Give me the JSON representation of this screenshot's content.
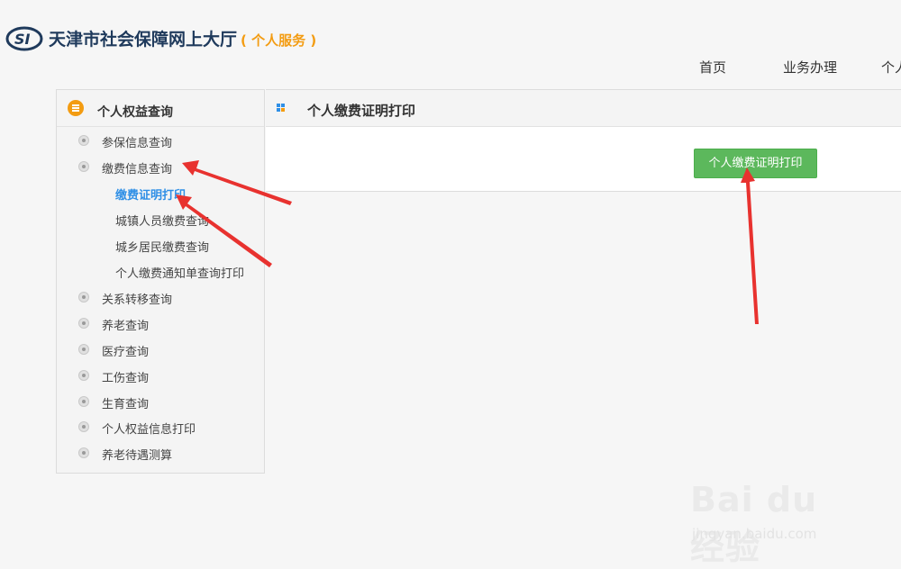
{
  "header": {
    "title": "天津市社会保障网上大厅",
    "subtitle": "( 个人服务 )",
    "logo_text": "SI",
    "nav": [
      "首页",
      "业务办理",
      "个人"
    ]
  },
  "sidebar": {
    "heading": "个人权益查询",
    "items": [
      {
        "label": "参保信息查询"
      },
      {
        "label": "缴费信息查询",
        "children": [
          {
            "label": "缴费证明打印",
            "active": true
          },
          {
            "label": "城镇人员缴费查询"
          },
          {
            "label": "城乡居民缴费查询"
          },
          {
            "label": "个人缴费通知单查询打印"
          }
        ]
      },
      {
        "label": "关系转移查询"
      },
      {
        "label": "养老查询"
      },
      {
        "label": "医疗查询"
      },
      {
        "label": "工伤查询"
      },
      {
        "label": "生育查询"
      },
      {
        "label": "个人权益信息打印"
      },
      {
        "label": "养老待遇测算"
      }
    ]
  },
  "panel": {
    "title": "个人缴费证明打印",
    "button_label": "个人缴费证明打印"
  },
  "watermark": {
    "text": "Bai du 经验",
    "url": "jingyan.baidu.com"
  },
  "colors": {
    "accent_orange": "#f39c12",
    "link_blue": "#2f8fe6",
    "button_green": "#5cb85c",
    "arrow_red": "#e8322f",
    "title_navy": "#1f3a5c"
  }
}
